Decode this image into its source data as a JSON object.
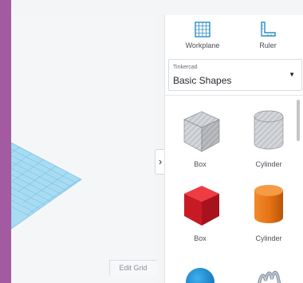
{
  "toolbar": {
    "workplane_label": "Workplane",
    "ruler_label": "Ruler"
  },
  "library": {
    "label": "Tinkercad",
    "selected_category": "Basic Shapes"
  },
  "shapes": [
    {
      "label": "Box",
      "color": "#b8bcc3",
      "style": "hole"
    },
    {
      "label": "Cylinder",
      "color": "#b8bcc3",
      "style": "hole"
    },
    {
      "label": "Box",
      "color": "#d31f2a"
    },
    {
      "label": "Cylinder",
      "color": "#ec7a1c"
    }
  ],
  "canvas": {
    "edit_grid_label": "Edit Grid"
  },
  "colors": {
    "frame_accent": "#a45aa0",
    "workplane_blue": "#9bd8f2",
    "icon_blue": "#2b8dc2"
  }
}
